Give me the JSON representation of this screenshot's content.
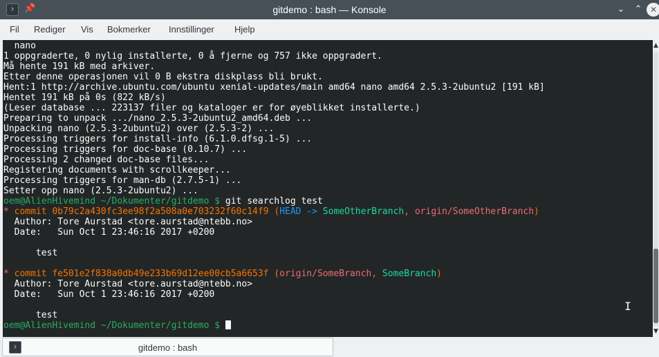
{
  "window": {
    "title": "gitdemo : bash — Konsole",
    "app_icon": "terminal-icon",
    "pin_icon": "pin-icon",
    "minimize_glyph": "⌄",
    "maximize_glyph": "⌃",
    "close_glyph": "✕"
  },
  "menu": {
    "items": [
      "Fil",
      "Rediger",
      "Vis",
      "Bokmerker",
      "Innstillinger",
      "Hjelp"
    ]
  },
  "terminal": {
    "colors": {
      "background": "#232627",
      "foreground": "#fcfcfc",
      "prompt": "#27ae60",
      "commit": "#f67400",
      "head": "#1d99f3",
      "remote_branch": "#ed6c72",
      "local_branch": "#1cdc9a"
    },
    "lines": [
      [
        {
          "t": "  nano"
        }
      ],
      [
        {
          "t": "1 oppgraderte, 0 nylig installerte, 0 å fjerne og 757 ikke oppgradert."
        }
      ],
      [
        {
          "t": "Må hente 191 kB med arkiver."
        }
      ],
      [
        {
          "t": "Etter denne operasjonen vil 0 B ekstra diskplass bli brukt."
        }
      ],
      [
        {
          "t": "Hent:1 http://archive.ubuntu.com/ubuntu xenial-updates/main amd64 nano amd64 2.5.3-2ubuntu2 [191 kB]"
        }
      ],
      [
        {
          "t": "Hentet 191 kB på 0s (822 kB/s)"
        }
      ],
      [
        {
          "t": "(Leser database ... 223137 filer og kataloger er for øyeblikket installerte.)"
        }
      ],
      [
        {
          "t": "Preparing to unpack .../nano_2.5.3-2ubuntu2_amd64.deb ..."
        }
      ],
      [
        {
          "t": "Unpacking nano (2.5.3-2ubuntu2) over (2.5.3-2) ..."
        }
      ],
      [
        {
          "t": "Processing triggers for install-info (6.1.0.dfsg.1-5) ..."
        }
      ],
      [
        {
          "t": "Processing triggers for doc-base (0.10.7) ..."
        }
      ],
      [
        {
          "t": "Processing 2 changed doc-base files..."
        }
      ],
      [
        {
          "t": "Registering documents with scrollkeeper..."
        }
      ],
      [
        {
          "t": "Processing triggers for man-db (2.7.5-1) ..."
        }
      ],
      [
        {
          "t": "Setter opp nano (2.5.3-2ubuntu2) ..."
        }
      ],
      [
        {
          "t": "oem@AlienHivemind ~/Dokumenter/gitdemo $",
          "c": "g"
        },
        {
          "t": " git searchlog test"
        }
      ],
      [
        {
          "t": "* ",
          "c": "r"
        },
        {
          "t": "commit 0b79c2a430fc3ee98f2a508a0e703232f60c14f9",
          "c": "y"
        },
        {
          "t": " (",
          "c": "y"
        },
        {
          "t": "HEAD -> ",
          "c": "b"
        },
        {
          "t": "SomeOtherBranch",
          "c": "gr"
        },
        {
          "t": ", ",
          "c": "y"
        },
        {
          "t": "origin/SomeOtherBranch",
          "c": "r"
        },
        {
          "t": ")",
          "c": "y"
        }
      ],
      [
        {
          "t": "  Author: Tore Aurstad <tore.aurstad@ntebb.no>"
        }
      ],
      [
        {
          "t": "  Date:   Sun Oct 1 23:46:16 2017 +0200"
        }
      ],
      [
        {
          "t": ""
        }
      ],
      [
        {
          "t": "      test"
        }
      ],
      [
        {
          "t": ""
        }
      ],
      [
        {
          "t": "* ",
          "c": "r"
        },
        {
          "t": "commit fe501e2f838a0db49e233b69d12ee00cb5a6653f",
          "c": "y"
        },
        {
          "t": " (",
          "c": "y"
        },
        {
          "t": "origin/SomeBranch",
          "c": "r"
        },
        {
          "t": ", ",
          "c": "y"
        },
        {
          "t": "SomeBranch",
          "c": "gr"
        },
        {
          "t": ")",
          "c": "y"
        }
      ],
      [
        {
          "t": "  Author: Tore Aurstad <tore.aurstad@ntebb.no>"
        }
      ],
      [
        {
          "t": "  Date:   Sun Oct 1 23:46:16 2017 +0200"
        }
      ],
      [
        {
          "t": ""
        }
      ],
      [
        {
          "t": "      test"
        }
      ],
      [
        {
          "t": "oem@AlienHivemind ~/Dokumenter/gitdemo $",
          "c": "g"
        },
        {
          "t": " "
        },
        {
          "cursor": true
        }
      ]
    ]
  },
  "tabs": [
    {
      "label": "gitdemo : bash",
      "icon": "terminal-icon"
    }
  ]
}
